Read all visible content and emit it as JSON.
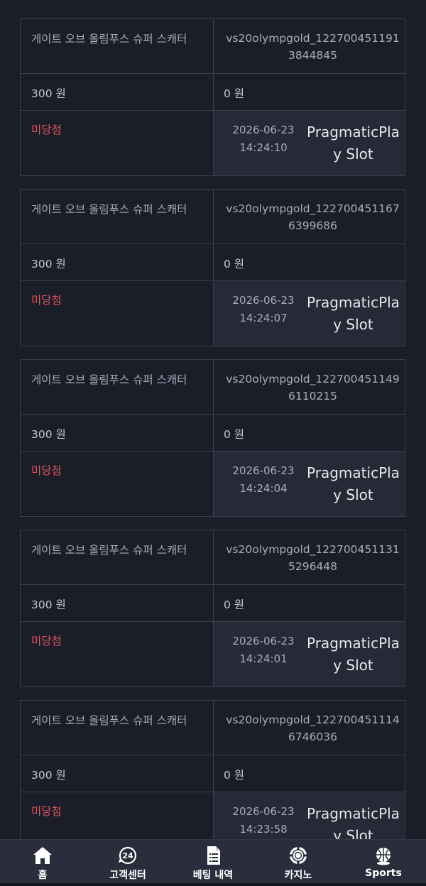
{
  "records": [
    {
      "game": "게이트 오브 올림푸스 슈퍼 스캐터",
      "bet_id": "vs20olympgold_1227004511913844845",
      "bet_amount": "300 원",
      "win_amount": "0 원",
      "status": "미당첨",
      "date": "2026-06-23",
      "time": "14:24:10",
      "provider": "PragmaticPlay Slot"
    },
    {
      "game": "게이트 오브 올림푸스 슈퍼 스캐터",
      "bet_id": "vs20olympgold_1227004511676399686",
      "bet_amount": "300 원",
      "win_amount": "0 원",
      "status": "미당첨",
      "date": "2026-06-23",
      "time": "14:24:07",
      "provider": "PragmaticPlay Slot"
    },
    {
      "game": "게이트 오브 올림푸스 슈퍼 스캐터",
      "bet_id": "vs20olympgold_1227004511496110215",
      "bet_amount": "300 원",
      "win_amount": "0 원",
      "status": "미당첨",
      "date": "2026-06-23",
      "time": "14:24:04",
      "provider": "PragmaticPlay Slot"
    },
    {
      "game": "게이트 오브 올림푸스 슈퍼 스캐터",
      "bet_id": "vs20olympgold_1227004511315296448",
      "bet_amount": "300 원",
      "win_amount": "0 원",
      "status": "미당첨",
      "date": "2026-06-23",
      "time": "14:24:01",
      "provider": "PragmaticPlay Slot"
    },
    {
      "game": "게이트 오브 올림푸스 슈퍼 스캐터",
      "bet_id": "vs20olympgold_1227004511146746036",
      "bet_amount": "300 원",
      "win_amount": "0 원",
      "status": "미당첨",
      "date": "2026-06-23",
      "time": "14:23:58",
      "provider": "PragmaticPlay Slot"
    }
  ],
  "nav": [
    {
      "label": "홈",
      "icon": "home-icon"
    },
    {
      "label": "고객센터",
      "icon": "support-24-icon",
      "icon_text": "24"
    },
    {
      "label": "베팅 내역",
      "icon": "document-icon"
    },
    {
      "label": "카지노",
      "icon": "casino-chip-icon"
    },
    {
      "label": "Sports",
      "icon": "sports-ball-icon"
    }
  ],
  "colors": {
    "background": "#1b1e29",
    "border": "#3a3f4e",
    "status_lose": "#e0545a",
    "nav_bg": "#2a2e3c"
  }
}
